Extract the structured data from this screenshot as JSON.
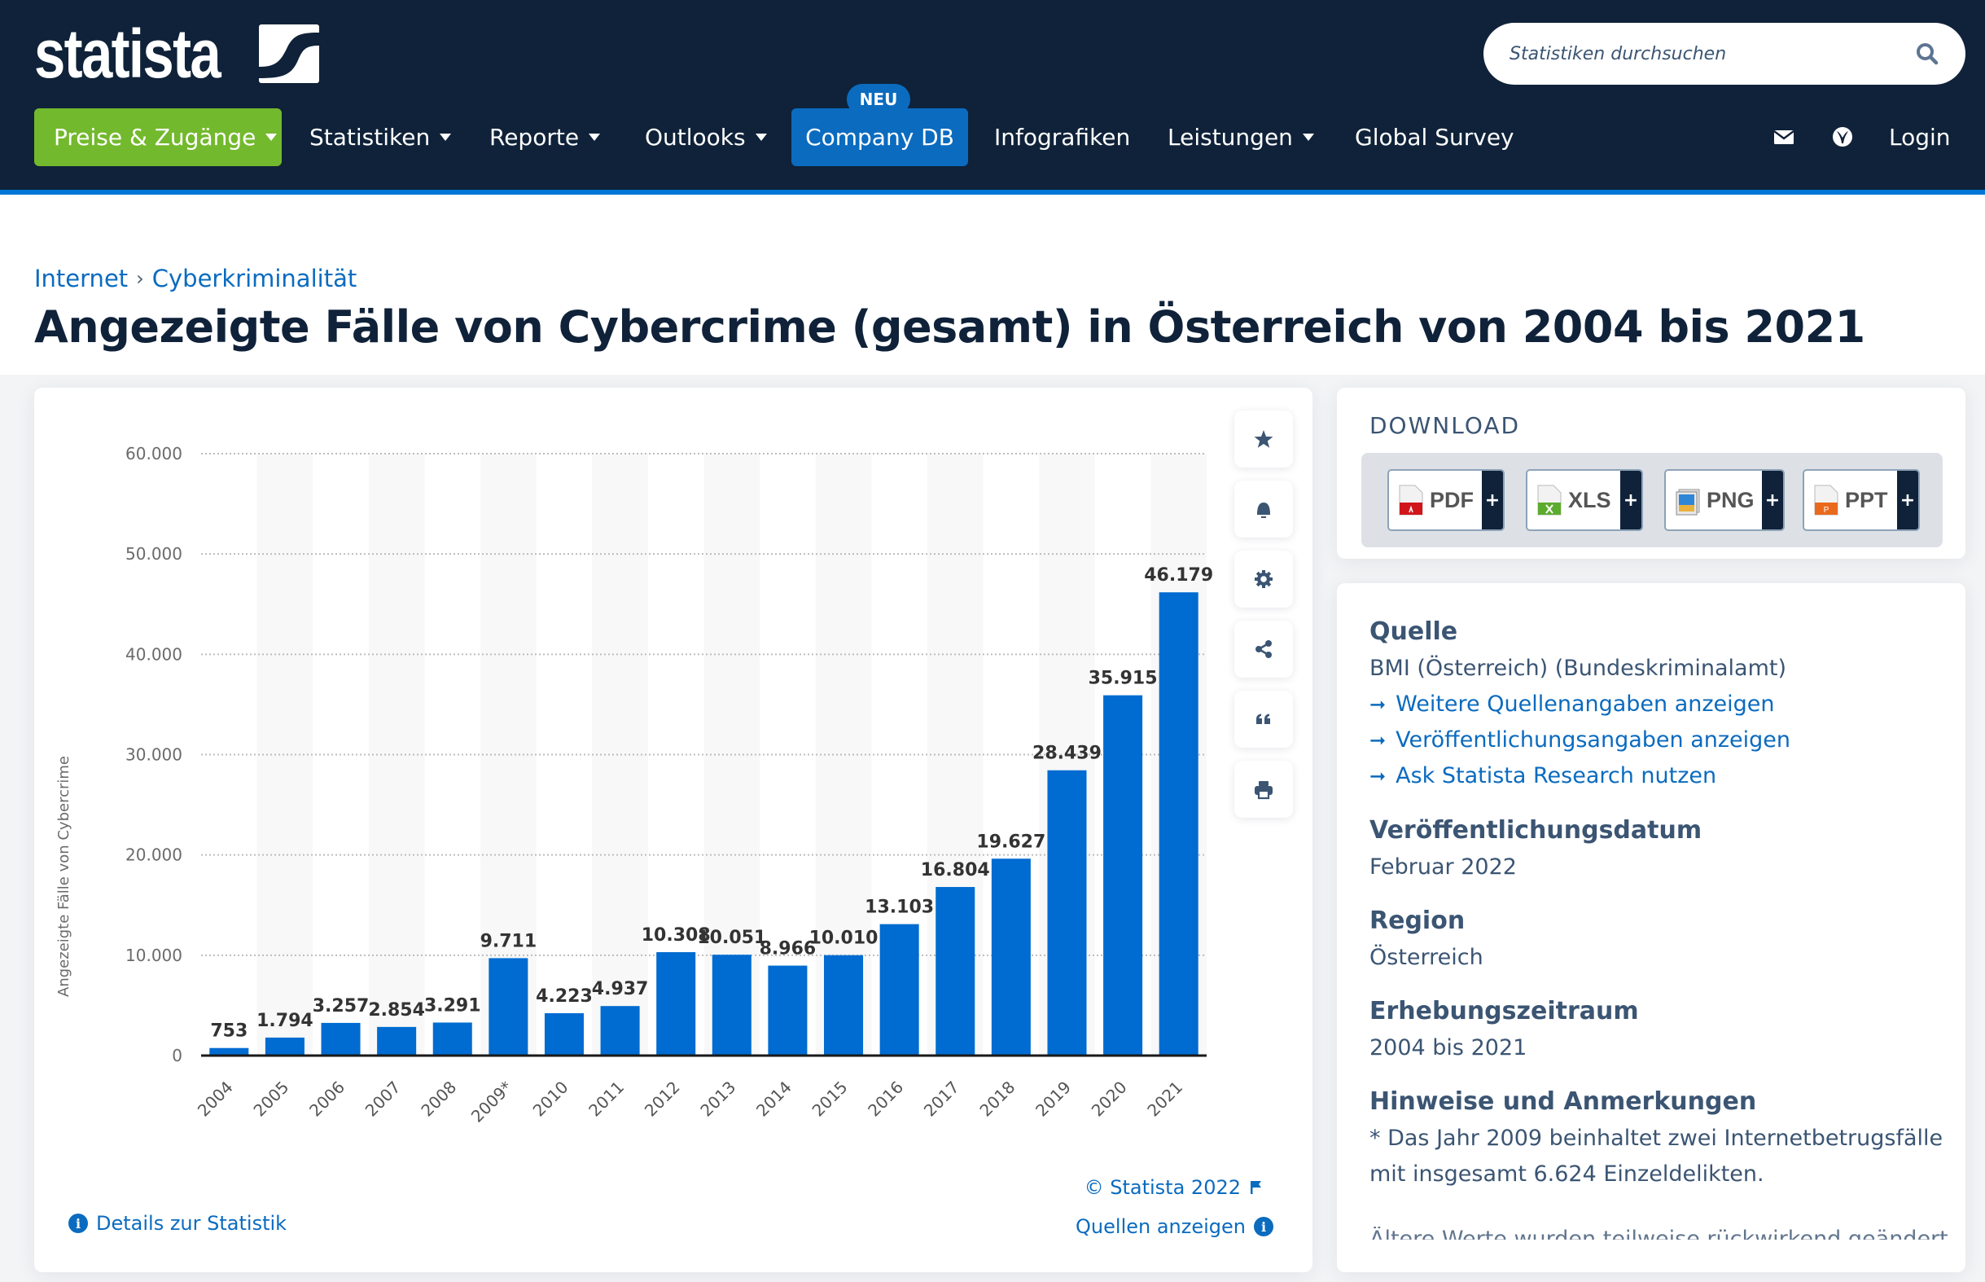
{
  "header": {
    "logo_text": "statista",
    "search": {
      "placeholder": "Statistiken durchsuchen"
    },
    "nav": [
      {
        "label": "Preise & Zugänge",
        "has_caret": true,
        "style": "green"
      },
      {
        "label": "Statistiken",
        "has_caret": true
      },
      {
        "label": "Reporte",
        "has_caret": true
      },
      {
        "label": "Outlooks",
        "has_caret": true
      },
      {
        "label": "Company DB",
        "has_caret": false,
        "style": "blue",
        "badge": "NEU"
      },
      {
        "label": "Infografiken",
        "has_caret": false
      },
      {
        "label": "Leistungen",
        "has_caret": true
      },
      {
        "label": "Global Survey",
        "has_caret": false
      }
    ],
    "icons": [
      "mail-icon",
      "globe-icon"
    ],
    "login_label": "Login"
  },
  "breadcrumb": [
    {
      "label": "Internet"
    },
    {
      "label": "Cyberkriminalität"
    }
  ],
  "breadcrumb_sep": "›",
  "page_title": "Angezeigte Fälle von Cybercrime (gesamt) in Österreich von 2004 bis 2021",
  "chart_tools": [
    "star-icon",
    "bell-icon",
    "gear-icon",
    "share-icon",
    "quote-icon",
    "print-icon"
  ],
  "chart_footer": {
    "copyright": "© Statista 2022",
    "details_label": "Details zur Statistik",
    "sources_label": "Quellen anzeigen"
  },
  "chart_data": {
    "type": "bar",
    "title": "Angezeigte Fälle von Cybercrime (gesamt) in Österreich von 2004 bis 2021",
    "xlabel": "",
    "ylabel": "Angezeigte Fälle von Cybercrime",
    "categories": [
      "2004",
      "2005",
      "2006",
      "2007",
      "2008",
      "2009*",
      "2010",
      "2011",
      "2012",
      "2013",
      "2014",
      "2015",
      "2016",
      "2017",
      "2018",
      "2019",
      "2020",
      "2021"
    ],
    "values": [
      753,
      1794,
      3257,
      2854,
      3291,
      9711,
      4223,
      4937,
      10308,
      10051,
      8966,
      10010,
      13103,
      16804,
      19627,
      28439,
      35915,
      46179
    ],
    "value_labels": [
      "753",
      "1.794",
      "3.257",
      "2.854",
      "3.291",
      "9.711",
      "4.223",
      "4.937",
      "10.308",
      "10.051",
      "8.966",
      "10.010",
      "13.103",
      "16.804",
      "19.627",
      "28.439",
      "35.915",
      "46.179"
    ],
    "ylim": [
      0,
      60000
    ],
    "yticks": [
      0,
      10000,
      20000,
      30000,
      40000,
      50000,
      60000
    ],
    "ytick_labels": [
      "0",
      "10.000",
      "20.000",
      "30.000",
      "40.000",
      "50.000",
      "60.000"
    ],
    "grid": true,
    "legend": "none",
    "bar_color": "#006bd1"
  },
  "download": {
    "title": "DOWNLOAD",
    "buttons": [
      {
        "label": "PDF",
        "icon": "pdf-file-icon",
        "plus": "+"
      },
      {
        "label": "XLS",
        "icon": "xls-file-icon",
        "plus": "+"
      },
      {
        "label": "PNG",
        "icon": "png-file-icon",
        "plus": "+"
      },
      {
        "label": "PPT",
        "icon": "ppt-file-icon",
        "plus": "+"
      }
    ]
  },
  "info": {
    "source_heading": "Quelle",
    "source_value": "BMI (Österreich) (Bundeskriminalamt)",
    "source_links": [
      "Weitere Quellenangaben anzeigen",
      "Veröffentlichungsangaben anzeigen",
      "Ask Statista Research nutzen"
    ],
    "pubdate_heading": "Veröffentlichungsdatum",
    "pubdate_value": "Februar 2022",
    "region_heading": "Region",
    "region_value": "Österreich",
    "period_heading": "Erhebungszeitraum",
    "period_value": "2004 bis 2021",
    "notes_heading": "Hinweise und Anmerkungen",
    "notes_lines": [
      "* Das Jahr 2009 beinhaltet zwei Internetbetrugsfälle",
      "mit insgesamt 6.624 Einzeldelikten."
    ],
    "notes_more_cut": "Ältere Werte wurden teilweise rückwirkend geändert"
  }
}
